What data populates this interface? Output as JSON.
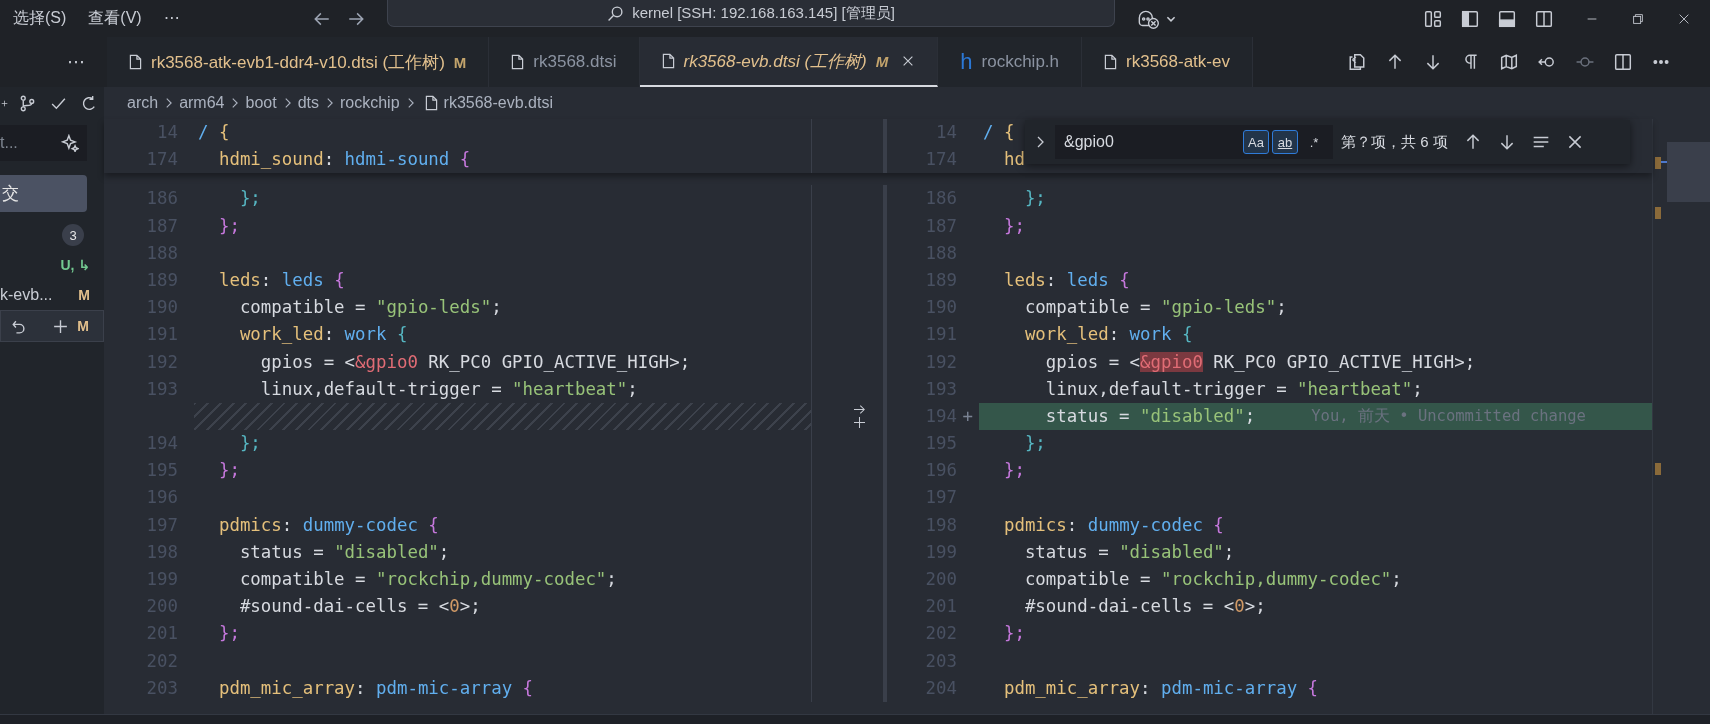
{
  "title_bar": {
    "menus": [
      "选择(S)",
      "查看(V)",
      "⋯"
    ],
    "command_center": "kernel [SSH: 192.168.163.145] [管理员]"
  },
  "tabs_overflow": "⋯",
  "tabs": [
    {
      "label": "rk3568-atk-evb1-ddr4-v10.dtsi (工作树)",
      "badge": "M",
      "kind": "file",
      "modified": true,
      "selected": false,
      "preview": false
    },
    {
      "label": "rk3568.dtsi",
      "kind": "file",
      "modified": false,
      "selected": false,
      "preview": false
    },
    {
      "label": "rk3568-evb.dtsi (工作树)",
      "badge": "M",
      "kind": "file",
      "modified": true,
      "selected": true,
      "preview": true
    },
    {
      "label": "rockchip.h",
      "kind": "header",
      "icon": "h",
      "modified": false,
      "selected": false,
      "preview": false
    },
    {
      "label": "rk3568-atk-ev",
      "kind": "file",
      "modified": true,
      "selected": false,
      "preview": false
    }
  ],
  "breadcrumb": [
    "arch",
    "arm64",
    "boot",
    "dts",
    "rockchip",
    "rk3568-evb.dtsi"
  ],
  "sidebar": {
    "search_value": "t...",
    "commit_label": "交",
    "changes_count": "3",
    "items": [
      {
        "status": "U, ↳",
        "color": "#73c991",
        "selected": false
      },
      {
        "name": "k-evb...",
        "status": "M",
        "color": "#e2c08d",
        "selected": false
      },
      {
        "status": "M",
        "color": "#e2c08d",
        "selected": true
      }
    ]
  },
  "find": {
    "value": "&gpio0",
    "toggles": [
      {
        "label": "Aa",
        "on": true
      },
      {
        "label": "ab",
        "on": true
      },
      {
        "label": ".*",
        "on": false
      }
    ],
    "result": "第？项，共 6 项"
  },
  "sticky_rows": [
    {
      "left": {
        "no": "14",
        "tokens": [
          {
            "text": "/",
            "kind": "slash"
          },
          {
            "text": " {",
            "kind": "b1"
          }
        ]
      },
      "right": {
        "no": "14",
        "tokens": [
          {
            "text": "/",
            "kind": "slash"
          },
          {
            "text": " {",
            "kind": "b1"
          }
        ]
      }
    },
    {
      "left": {
        "no": "174",
        "tokens": [
          {
            "text": "  hdmi_sound",
            "kind": "label"
          },
          {
            "text": ": ",
            "kind": "plain"
          },
          {
            "text": "hdmi-sound",
            "kind": "node"
          },
          {
            "text": " {",
            "kind": "b2"
          }
        ]
      },
      "right": {
        "no": "174",
        "tokens": [
          {
            "text": "  hd",
            "kind": "label"
          }
        ]
      }
    }
  ],
  "diff_rows": [
    {
      "left": {
        "kind": "code",
        "no": "186",
        "tokens": [
          {
            "text": "    };",
            "kind": "b3"
          }
        ]
      },
      "right": {
        "kind": "code",
        "no": "186",
        "tokens": [
          {
            "text": "    };",
            "kind": "b3"
          }
        ]
      }
    },
    {
      "left": {
        "kind": "code",
        "no": "187",
        "tokens": [
          {
            "text": "  };",
            "kind": "b2"
          }
        ]
      },
      "right": {
        "kind": "code",
        "no": "187",
        "tokens": [
          {
            "text": "  };",
            "kind": "b2"
          }
        ]
      }
    },
    {
      "left": {
        "kind": "code",
        "no": "188"
      },
      "right": {
        "kind": "code",
        "no": "188"
      }
    },
    {
      "left": {
        "kind": "code",
        "no": "189",
        "tokens": [
          {
            "text": "  leds",
            "kind": "label"
          },
          {
            "text": ": ",
            "kind": "plain"
          },
          {
            "text": "leds",
            "kind": "node"
          },
          {
            "text": " {",
            "kind": "b2"
          }
        ]
      },
      "right": {
        "kind": "code",
        "no": "189",
        "tokens": [
          {
            "text": "  leds",
            "kind": "label"
          },
          {
            "text": ": ",
            "kind": "plain"
          },
          {
            "text": "leds",
            "kind": "node"
          },
          {
            "text": " {",
            "kind": "b2"
          }
        ]
      }
    },
    {
      "left": {
        "kind": "code",
        "no": "190",
        "tokens": [
          {
            "text": "    compatible = ",
            "kind": "plain"
          },
          {
            "text": "\"gpio-leds\"",
            "kind": "string"
          },
          {
            "text": ";",
            "kind": "plain"
          }
        ]
      },
      "right": {
        "kind": "code",
        "no": "190",
        "tokens": [
          {
            "text": "    compatible = ",
            "kind": "plain"
          },
          {
            "text": "\"gpio-leds\"",
            "kind": "string"
          },
          {
            "text": ";",
            "kind": "plain"
          }
        ]
      }
    },
    {
      "left": {
        "kind": "code",
        "no": "191",
        "tokens": [
          {
            "text": "    work_led",
            "kind": "label"
          },
          {
            "text": ": ",
            "kind": "plain"
          },
          {
            "text": "work",
            "kind": "node"
          },
          {
            "text": " {",
            "kind": "b3"
          }
        ]
      },
      "right": {
        "kind": "code",
        "no": "191",
        "tokens": [
          {
            "text": "    work_led",
            "kind": "label"
          },
          {
            "text": ": ",
            "kind": "plain"
          },
          {
            "text": "work",
            "kind": "node"
          },
          {
            "text": " {",
            "kind": "b3"
          }
        ]
      }
    },
    {
      "left": {
        "kind": "code",
        "no": "192",
        "tokens": [
          {
            "text": "      gpios = <",
            "kind": "plain"
          },
          {
            "text": "&gpio0",
            "kind": "ref",
            "highlight": false
          },
          {
            "text": " RK_PC0 GPIO_ACTIVE_HIGH>;",
            "kind": "plain"
          }
        ]
      },
      "right": {
        "kind": "code",
        "no": "192",
        "tokens": [
          {
            "text": "      gpios = <",
            "kind": "plain"
          },
          {
            "text": "&gpio0",
            "kind": "ref",
            "highlight": true
          },
          {
            "text": " RK_PC0 GPIO_ACTIVE_HIGH>;",
            "kind": "plain"
          }
        ]
      }
    },
    {
      "left": {
        "kind": "code",
        "no": "193",
        "tokens": [
          {
            "text": "      linux,default-trigger = ",
            "kind": "plain"
          },
          {
            "text": "\"heartbeat\"",
            "kind": "string"
          },
          {
            "text": ";",
            "kind": "plain"
          }
        ]
      },
      "right": {
        "kind": "code",
        "no": "193",
        "tokens": [
          {
            "text": "      linux,default-trigger = ",
            "kind": "plain"
          },
          {
            "text": "\"heartbeat\"",
            "kind": "string"
          },
          {
            "text": ";",
            "kind": "plain"
          }
        ]
      }
    },
    {
      "left": {
        "kind": "filler"
      },
      "right": {
        "kind": "added",
        "no": "194",
        "marker": "+",
        "tokens": [
          {
            "text": "      status = ",
            "kind": "plain"
          },
          {
            "text": "\"disabled\"",
            "kind": "string"
          },
          {
            "text": ";",
            "kind": "plain"
          }
        ],
        "blame": "You, 前天 • Uncommitted change"
      }
    },
    {
      "left": {
        "kind": "code",
        "no": "194",
        "tokens": [
          {
            "text": "    };",
            "kind": "b3"
          }
        ]
      },
      "right": {
        "kind": "code",
        "no": "195",
        "tokens": [
          {
            "text": "    };",
            "kind": "b3"
          }
        ]
      }
    },
    {
      "left": {
        "kind": "code",
        "no": "195",
        "tokens": [
          {
            "text": "  };",
            "kind": "b2"
          }
        ]
      },
      "right": {
        "kind": "code",
        "no": "196",
        "tokens": [
          {
            "text": "  };",
            "kind": "b2"
          }
        ]
      }
    },
    {
      "left": {
        "kind": "code",
        "no": "196"
      },
      "right": {
        "kind": "code",
        "no": "197"
      }
    },
    {
      "left": {
        "kind": "code",
        "no": "197",
        "tokens": [
          {
            "text": "  pdmics",
            "kind": "label"
          },
          {
            "text": ": ",
            "kind": "plain"
          },
          {
            "text": "dummy-codec",
            "kind": "node"
          },
          {
            "text": " {",
            "kind": "b2"
          }
        ]
      },
      "right": {
        "kind": "code",
        "no": "198",
        "tokens": [
          {
            "text": "  pdmics",
            "kind": "label"
          },
          {
            "text": ": ",
            "kind": "plain"
          },
          {
            "text": "dummy-codec",
            "kind": "node"
          },
          {
            "text": " {",
            "kind": "b2"
          }
        ]
      }
    },
    {
      "left": {
        "kind": "code",
        "no": "198",
        "tokens": [
          {
            "text": "    status = ",
            "kind": "plain"
          },
          {
            "text": "\"disabled\"",
            "kind": "string"
          },
          {
            "text": ";",
            "kind": "plain"
          }
        ]
      },
      "right": {
        "kind": "code",
        "no": "199",
        "tokens": [
          {
            "text": "    status = ",
            "kind": "plain"
          },
          {
            "text": "\"disabled\"",
            "kind": "string"
          },
          {
            "text": ";",
            "kind": "plain"
          }
        ]
      }
    },
    {
      "left": {
        "kind": "code",
        "no": "199",
        "tokens": [
          {
            "text": "    compatible = ",
            "kind": "plain"
          },
          {
            "text": "\"rockchip,dummy-codec\"",
            "kind": "string"
          },
          {
            "text": ";",
            "kind": "plain"
          }
        ]
      },
      "right": {
        "kind": "code",
        "no": "200",
        "tokens": [
          {
            "text": "    compatible = ",
            "kind": "plain"
          },
          {
            "text": "\"rockchip,dummy-codec\"",
            "kind": "string"
          },
          {
            "text": ";",
            "kind": "plain"
          }
        ]
      }
    },
    {
      "left": {
        "kind": "code",
        "no": "200",
        "tokens": [
          {
            "text": "    #sound-dai-cells = <",
            "kind": "plain"
          },
          {
            "text": "0",
            "kind": "num"
          },
          {
            "text": ">;",
            "kind": "plain"
          }
        ]
      },
      "right": {
        "kind": "code",
        "no": "201",
        "tokens": [
          {
            "text": "    #sound-dai-cells = <",
            "kind": "plain"
          },
          {
            "text": "0",
            "kind": "num"
          },
          {
            "text": ">;",
            "kind": "plain"
          }
        ]
      }
    },
    {
      "left": {
        "kind": "code",
        "no": "201",
        "tokens": [
          {
            "text": "  };",
            "kind": "b2"
          }
        ]
      },
      "right": {
        "kind": "code",
        "no": "202",
        "tokens": [
          {
            "text": "  };",
            "kind": "b2"
          }
        ]
      }
    },
    {
      "left": {
        "kind": "code",
        "no": "202"
      },
      "right": {
        "kind": "code",
        "no": "203"
      }
    },
    {
      "left": {
        "kind": "code",
        "no": "203",
        "tokens": [
          {
            "text": "  pdm_mic_array",
            "kind": "label"
          },
          {
            "text": ": ",
            "kind": "plain"
          },
          {
            "text": "pdm-mic-array",
            "kind": "node"
          },
          {
            "text": " {",
            "kind": "b2"
          }
        ]
      },
      "right": {
        "kind": "code",
        "no": "204",
        "tokens": [
          {
            "text": "  pdm_mic_array",
            "kind": "label"
          },
          {
            "text": ": ",
            "kind": "plain"
          },
          {
            "text": "pdm-mic-array",
            "kind": "node"
          },
          {
            "text": " {",
            "kind": "b2"
          }
        ]
      }
    }
  ]
}
